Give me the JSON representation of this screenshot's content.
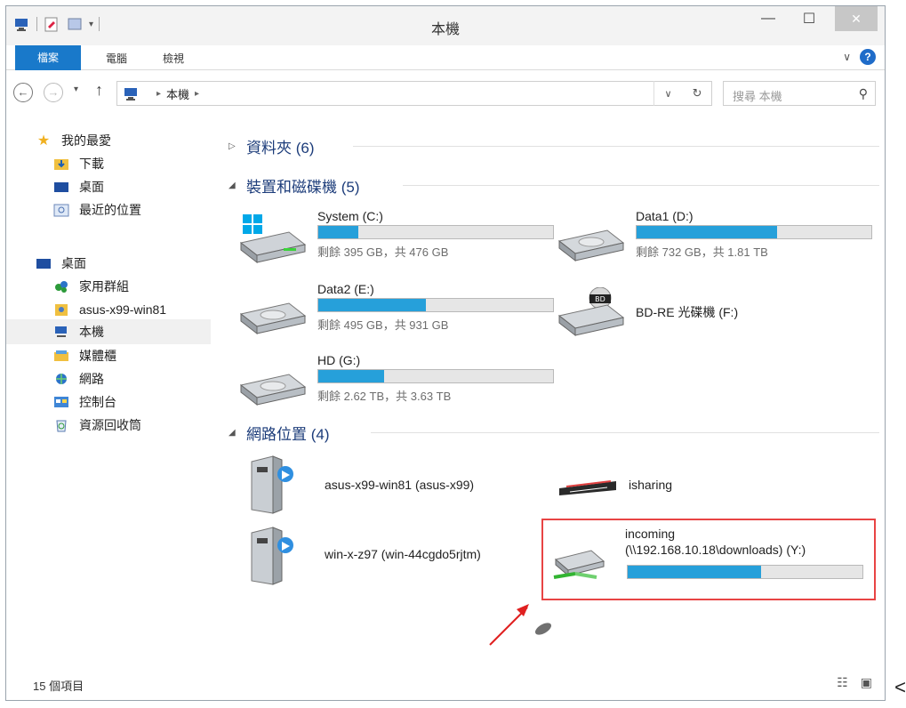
{
  "window": {
    "title": "本機"
  },
  "ribbon": {
    "tabs": [
      "檔案",
      "電腦",
      "檢視"
    ]
  },
  "address": {
    "breadcrumb": [
      "本機"
    ],
    "search_placeholder": "搜尋 本機"
  },
  "navpane": {
    "favorites_label": "我的最愛",
    "favorites": [
      "下載",
      "桌面",
      "最近的位置"
    ],
    "desktop_label": "桌面",
    "desktop_items": [
      "家用群組",
      "asus-x99-win81",
      "本機",
      "媒體櫃",
      "網路",
      "控制台",
      "資源回收筒"
    ]
  },
  "groups": {
    "folders": "資料夾 (6)",
    "devices": "裝置和磁碟機 (5)",
    "network": "網路位置 (4)"
  },
  "drives": [
    {
      "name": "System (C:)",
      "info": "剩餘 395 GB，共 476 GB",
      "used_fraction": 0.17,
      "icon": "windows-drive-icon"
    },
    {
      "name": "Data1 (D:)",
      "info": "剩餘 732 GB，共 1.81 TB",
      "used_fraction": 0.6,
      "icon": "hard-drive-icon"
    },
    {
      "name": "Data2 (E:)",
      "info": "剩餘 495 GB，共 931 GB",
      "used_fraction": 0.46,
      "icon": "hard-drive-icon"
    },
    {
      "name": "BD-RE 光碟機 (F:)",
      "icon": "bd-drive-icon"
    },
    {
      "name": "HD (G:)",
      "info": "剩餘 2.62 TB，共 3.63 TB",
      "used_fraction": 0.28,
      "icon": "hard-drive-icon"
    }
  ],
  "network": [
    {
      "name": "asus-x99-win81 (asus-x99)",
      "icon": "media-server-icon"
    },
    {
      "name": "isharing",
      "icon": "isharing-logo-icon"
    },
    {
      "name": "win-x-z97 (win-44cgdo5rjtm)",
      "icon": "media-server-icon"
    }
  ],
  "incoming": {
    "line1": "incoming",
    "line2": "(\\\\192.168.10.18\\downloads) (Y:)",
    "used_fraction": 0.57,
    "icon": "network-drive-icon"
  },
  "status": {
    "count": "15 個項目"
  },
  "colors": {
    "accent": "#1979ca",
    "bar_fill": "#26a0da",
    "highlight": "#e84444",
    "group_title": "#1c3c7a"
  },
  "edge_char": "<"
}
